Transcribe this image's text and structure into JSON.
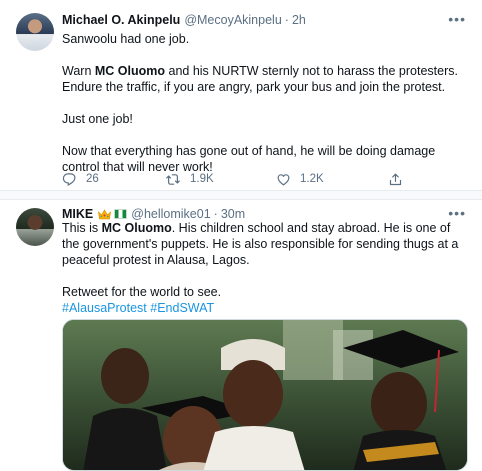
{
  "tweets": [
    {
      "name": "Michael O. Akinpelu",
      "handle": "@MecoyAkinpelu",
      "separator": "·",
      "time": "2h",
      "more": "•••",
      "paragraphs": [
        "Sanwoolu had one job.",
        "Warn ",
        "Just one job!",
        "Now that everything has gone out of hand, he will be doing damage control that will never work!"
      ],
      "p2_bold": "MC Oluomo",
      "p2_rest": " and his NURTW sternly not to harass the protesters. Endure the traffic, if you are angry, park your bus and join the protest.",
      "counts": {
        "reply": "26",
        "retweet": "1.9K",
        "like": "1.2K"
      },
      "icons": [
        "reply-icon",
        "retweet-icon",
        "like-icon",
        "share-icon"
      ]
    },
    {
      "name": "MIKE",
      "emoji": [
        "crown-emoji",
        "nigeria-flag-emoji"
      ],
      "handle": "@hellomike01",
      "separator": "·",
      "time": "30m",
      "more": "•••",
      "p1_pre": "This is ",
      "p1_bold": "MC Oluomo",
      "p1_rest": ". His children school and stay abroad. He is one of the government's puppets. He is also responsible for sending thugs at a peaceful protest in Alausa, Lagos.",
      "p2": "Retweet for the world to see.",
      "hashtags": [
        "#AlausaProtest",
        "#EndSWAT"
      ],
      "media_description": "photo"
    }
  ],
  "colors": {
    "text": "#0f1419",
    "secondary": "#5b7083",
    "link": "#1b95e0",
    "border": "#e6ecf0"
  }
}
